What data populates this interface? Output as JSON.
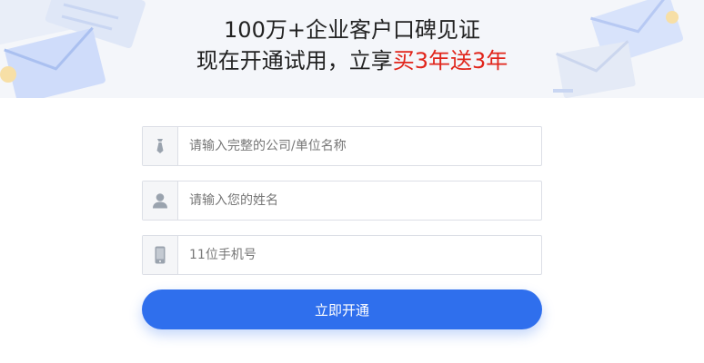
{
  "banner": {
    "headline_line1": "100万+企业客户口碑见证",
    "headline_line2_prefix": "现在开通试用，立享",
    "headline_line2_promo": "买3年送3年"
  },
  "form": {
    "company": {
      "placeholder": "请输入完整的公司/单位名称",
      "icon": "tie-icon"
    },
    "name": {
      "placeholder": "请输入您的姓名",
      "icon": "user-icon"
    },
    "phone": {
      "placeholder": "11位手机号",
      "icon": "phone-icon"
    },
    "submit_label": "立即开通"
  },
  "colors": {
    "accent": "#2f6fed",
    "promo": "#e1251b",
    "banner_bg": "#f4f6fa"
  }
}
